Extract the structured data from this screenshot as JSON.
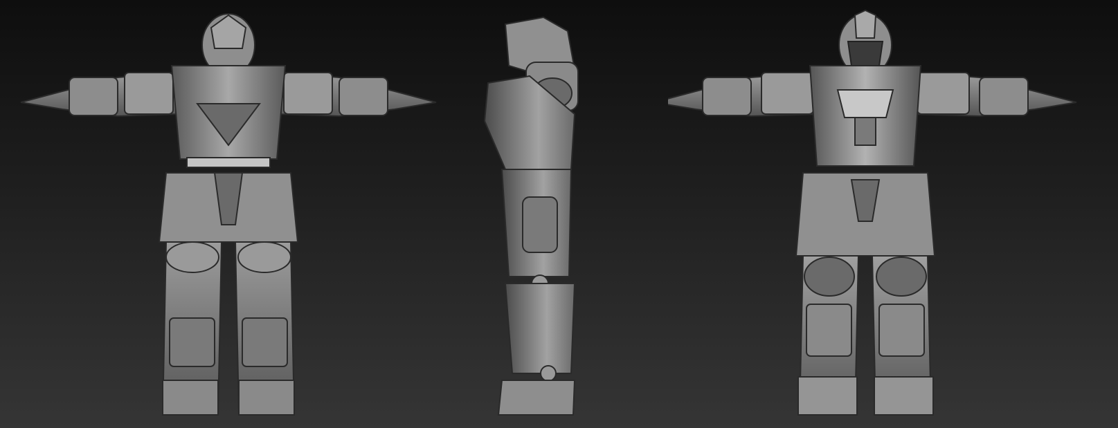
{
  "scene": {
    "views": [
      {
        "name": "back-view",
        "icon": "armored-figure-back"
      },
      {
        "name": "side-view",
        "icon": "armored-figure-side"
      },
      {
        "name": "front-view",
        "icon": "armored-figure-front"
      }
    ],
    "colors": {
      "background_top": "#0e0e0e",
      "background_bottom": "#353535",
      "armor_light": "#b8b8b8",
      "armor_mid": "#8a8a8a",
      "armor_dark": "#4a4a4a",
      "armor_shadow": "#2a2a2a"
    }
  }
}
